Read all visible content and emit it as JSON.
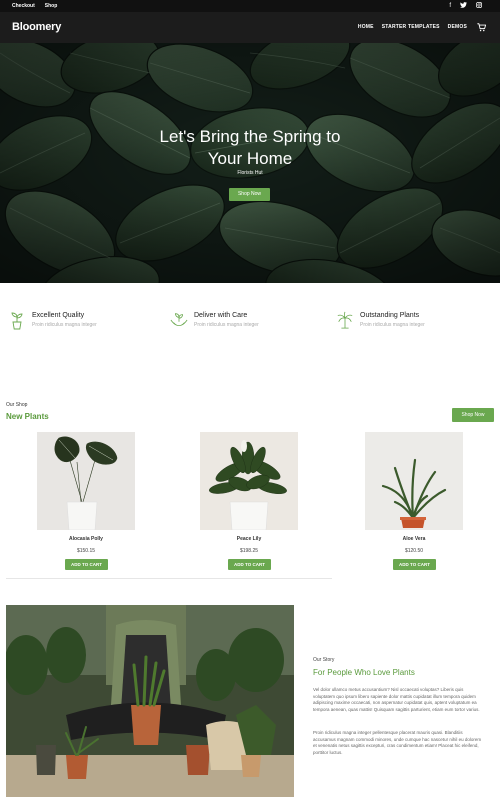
{
  "topbar": {
    "links": [
      "Checkout",
      "Shop"
    ],
    "social_icons": [
      "facebook-icon",
      "twitter-icon",
      "instagram-icon"
    ]
  },
  "header": {
    "logo": "Bloomery",
    "nav": [
      "HOME",
      "STARTER TEMPLATES",
      "DEMOS"
    ],
    "cart_icon": "cart-icon"
  },
  "hero": {
    "title_line1": "Let's Bring the Spring to",
    "title_line2": "Your Home",
    "subtitle": "Florists Hut",
    "button": "Shop Now"
  },
  "features": [
    {
      "icon": "potted-plant-icon",
      "title": "Excellent Quality",
      "subtitle": "Proin ridiculus magna integer"
    },
    {
      "icon": "hands-plant-icon",
      "title": "Deliver with Care",
      "subtitle": "Proin ridiculus magna integer"
    },
    {
      "icon": "palm-tree-icon",
      "title": "Outstanding Plants",
      "subtitle": "Proin ridiculus magna integer"
    }
  ],
  "shop": {
    "label": "Our Shop",
    "title": "New Plants",
    "button": "Shop Now"
  },
  "products": [
    {
      "name": "Alocasia Polly",
      "price": "$150.15",
      "button": "ADD TO CART"
    },
    {
      "name": "Peace Lily",
      "price": "$198.25",
      "button": "ADD TO CART"
    },
    {
      "name": "Aloe Vera",
      "price": "$120.50",
      "button": "ADD TO CART"
    }
  ],
  "story": {
    "label": "Our Story",
    "title": "For People Who Love Plants",
    "paragraph1": "Vel dolor ullamco metus accusantium? Nisl occaecati voluptas? Liberis quis voluptatem quo ipsum libero sapiente dolor mattis cupidatat illum tempora quidem adipiscing maxime occaecati, non aspernatur cupidatat quis, aptent voluptatum ea tempora aenean, quas mattis! Quisquam sagittis parturient, etiam eum tortor varius.",
    "paragraph2": "Proin ridiculus magna integer pellentesque placerat mauris quasi. Blanditiis accusamus magnam commodi minores, unde cumque hac nascetur nihil eu dolorem et venenatis netus sagittis excepturi, cras condimentum etiam! Placeat hic eleifend, porttitor luctus."
  },
  "colors": {
    "accent": "#6aa84f",
    "accent_text": "#5a9a3c",
    "header_bg": "#1c1c1c",
    "topbar_bg": "#111111"
  }
}
